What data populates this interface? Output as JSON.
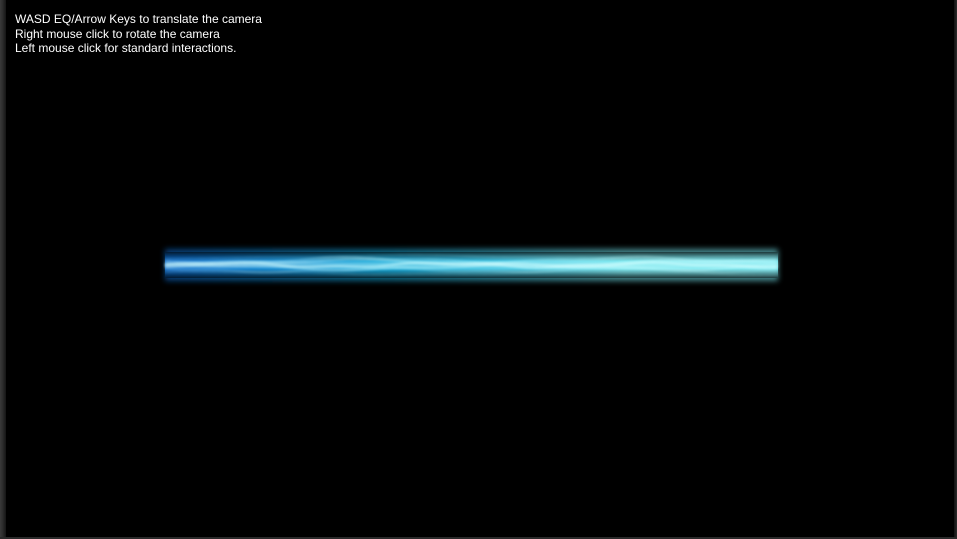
{
  "viewport": {
    "instructions": [
      "WASD EQ/Arrow Keys to translate the camera",
      "Right mouse click to rotate the camera",
      "Left mouse click for standard interactions."
    ]
  },
  "scene": {
    "object": "energy-beam",
    "colors": {
      "background": "#000000",
      "beam_dark": "#0a6fd6",
      "beam_mid": "#19b4e8",
      "beam_bright": "#7ff6ff",
      "beam_core": "#d8ffff"
    }
  }
}
